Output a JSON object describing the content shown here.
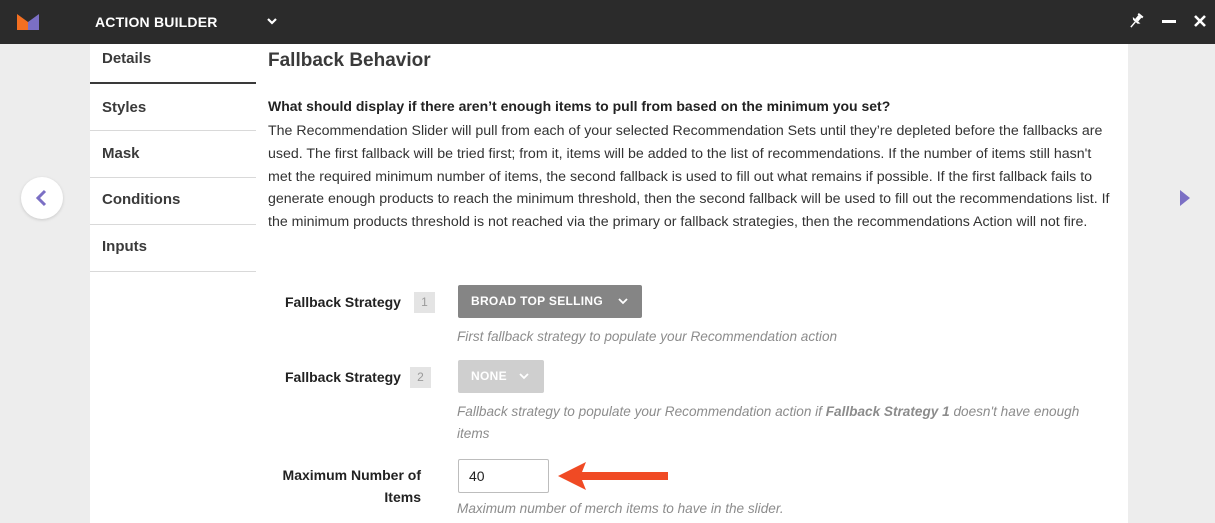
{
  "app": {
    "title": "ACTION BUILDER",
    "brand_colors": {
      "orange": "#f36f21",
      "purple": "#7b6fc4"
    }
  },
  "sidebar": {
    "items": [
      {
        "label": "Details",
        "active": true
      },
      {
        "label": "Styles",
        "active": false
      },
      {
        "label": "Mask",
        "active": false
      },
      {
        "label": "Conditions",
        "active": false
      },
      {
        "label": "Inputs",
        "active": false
      }
    ]
  },
  "content": {
    "title": "Fallback Behavior",
    "question": "What should display if there aren’t enough items to pull from based on the minimum you set?",
    "description": "The Recommendation Slider will pull from each of your selected Recommendation Sets until they’re depleted before the fallbacks are used. The first fallback will be tried first; from it, items will be added to the list of recommendations. If the number of items still hasn't met the required minimum number of items, the second fallback is used to fill out what remains if possible. If the first fallback fails to generate enough products to reach the minimum threshold, then the second fallback will be used to fill out the recommendations list. If the minimum products threshold is not reached via the primary or fallback strategies, then the recommendations Action will not fire.",
    "fallback1": {
      "label": "Fallback Strategy",
      "number": "1",
      "value": "BROAD TOP SELLING",
      "help": "First fallback strategy to populate your Recommendation action"
    },
    "fallback2": {
      "label": "Fallback Strategy",
      "number": "2",
      "value": "NONE",
      "help_prefix": "Fallback strategy to populate your Recommendation action if ",
      "help_bold": "Fallback Strategy 1",
      "help_suffix": " doesn't have enough items"
    },
    "max_items": {
      "label": "Maximum Number of Items",
      "value": "40",
      "help": "Maximum number of merch items to have in the slider."
    }
  },
  "icons": {
    "logo": "monetate-logo-icon",
    "title_chevron": "chevron-down-icon",
    "pin": "pin-icon",
    "minimize": "minimize-icon",
    "close": "close-icon",
    "prev": "chevron-left-icon",
    "next": "chevron-right-icon",
    "annotation": "red-arrow-icon"
  },
  "colors": {
    "topbar": "#2b2b2b",
    "dropdown_active": "#858585",
    "dropdown_disabled": "#cfcfcf",
    "arrow": "#f04a24"
  }
}
